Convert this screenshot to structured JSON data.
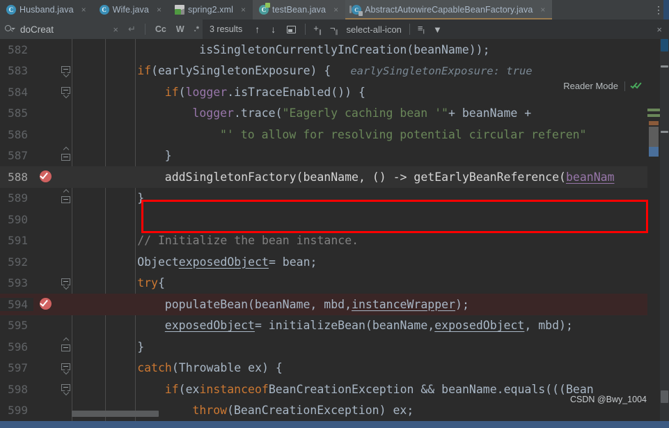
{
  "tabs": [
    {
      "label": "Husband.java",
      "icon": "java-class-icon",
      "state": "inactive",
      "close": "×"
    },
    {
      "label": "Wife.java",
      "icon": "java-class-icon",
      "state": "inactive",
      "close": "×"
    },
    {
      "label": "spring2.xml",
      "icon": "xml-file-icon",
      "state": "inactive",
      "close": "×"
    },
    {
      "label": "testBean.java",
      "icon": "java-test-class-icon",
      "state": "hover",
      "close": "×"
    },
    {
      "label": "AbstractAutowireCapableBeanFactory.java",
      "icon": "abstract-class-icon",
      "state": "active",
      "close": "×"
    }
  ],
  "tabbar": {
    "more_tabs": "⋮"
  },
  "find": {
    "search_icon": "search-icon",
    "query": "doCreat",
    "placeholder": "Search",
    "clear": "×",
    "wrap_icon": "new-line-icon",
    "match_case": "Cc",
    "words": "W",
    "regex": ".*",
    "results": "3 results",
    "prev": "↑",
    "next": "↓",
    "select_all_occurrences": "select-all-icon",
    "filter": "filter-icon",
    "close": "×"
  },
  "editor": {
    "reader_mode": "Reader Mode",
    "reader_check": "inspections-ok-icon",
    "first_line": 582,
    "lines": [
      {
        "num": "582",
        "fold": "",
        "marker": "",
        "state": "",
        "indent": 17,
        "tokens": [
          {
            "t": "isSingletonCurrentlyInCreation(beanName));",
            "c": "ident"
          }
        ]
      },
      {
        "num": "583",
        "fold": "start",
        "marker": "",
        "state": "",
        "indent": 8,
        "tokens": [
          {
            "t": "if",
            "c": "kw"
          },
          {
            "t": " (earlySingletonExposure) {",
            "c": "ident"
          }
        ],
        "hint": "earlySingletonExposure: true"
      },
      {
        "num": "584",
        "fold": "start",
        "marker": "",
        "state": "",
        "indent": 12,
        "tokens": [
          {
            "t": "if",
            "c": "kw"
          },
          {
            "t": " (",
            "c": "ident"
          },
          {
            "t": "logger",
            "c": "fld"
          },
          {
            "t": ".isTraceEnabled()) {",
            "c": "ident"
          }
        ]
      },
      {
        "num": "585",
        "fold": "",
        "marker": "",
        "state": "",
        "indent": 16,
        "tokens": [
          {
            "t": "logger",
            "c": "fld"
          },
          {
            "t": ".trace(",
            "c": "ident"
          },
          {
            "t": "\"Eagerly caching bean '\"",
            "c": "str"
          },
          {
            "t": " + beanName +",
            "c": "ident"
          }
        ]
      },
      {
        "num": "586",
        "fold": "",
        "marker": "",
        "state": "",
        "indent": 20,
        "tokens": [
          {
            "t": "\"' to allow for resolving potential circular referen\"",
            "c": "str"
          }
        ]
      },
      {
        "num": "587",
        "fold": "end",
        "marker": "",
        "state": "",
        "indent": 12,
        "tokens": [
          {
            "t": "}",
            "c": "ident"
          }
        ]
      },
      {
        "num": "588",
        "fold": "",
        "marker": "breakpoint-verified",
        "state": "selected",
        "indent": 12,
        "tokens": [
          {
            "t": "addSingletonFactory(beanName, () -> getEarlyBeanReference(",
            "c": "white"
          },
          {
            "t": "beanNam",
            "c": "purpund"
          }
        ]
      },
      {
        "num": "589",
        "fold": "end",
        "marker": "",
        "state": "",
        "indent": 8,
        "tokens": [
          {
            "t": "}",
            "c": "ident"
          }
        ]
      },
      {
        "num": "590",
        "fold": "",
        "marker": "",
        "state": "",
        "indent": 0,
        "tokens": []
      },
      {
        "num": "591",
        "fold": "",
        "marker": "",
        "state": "",
        "indent": 8,
        "tokens": [
          {
            "t": "// Initialize the bean instance.",
            "c": "cmt"
          }
        ]
      },
      {
        "num": "592",
        "fold": "",
        "marker": "",
        "state": "",
        "indent": 8,
        "tokens": [
          {
            "t": "Object ",
            "c": "ident"
          },
          {
            "t": "exposedObject",
            "c": "undv"
          },
          {
            "t": " = bean;",
            "c": "ident"
          }
        ]
      },
      {
        "num": "593",
        "fold": "start",
        "marker": "",
        "state": "",
        "indent": 8,
        "tokens": [
          {
            "t": "try",
            "c": "kw"
          },
          {
            "t": " {",
            "c": "ident"
          }
        ]
      },
      {
        "num": "594",
        "fold": "",
        "marker": "breakpoint-verified",
        "state": "error",
        "indent": 12,
        "tokens": [
          {
            "t": "populateBean(beanName, mbd, ",
            "c": "ident"
          },
          {
            "t": "instanceWrapper",
            "c": "undv"
          },
          {
            "t": ");",
            "c": "ident"
          }
        ]
      },
      {
        "num": "595",
        "fold": "",
        "marker": "",
        "state": "",
        "indent": 12,
        "tokens": [
          {
            "t": "exposedObject",
            "c": "undv"
          },
          {
            "t": " = initializeBean(beanName, ",
            "c": "ident"
          },
          {
            "t": "exposedObject",
            "c": "undv"
          },
          {
            "t": ", mbd);",
            "c": "ident"
          }
        ]
      },
      {
        "num": "596",
        "fold": "end",
        "marker": "",
        "state": "",
        "indent": 8,
        "tokens": [
          {
            "t": "}",
            "c": "ident"
          }
        ]
      },
      {
        "num": "597",
        "fold": "start",
        "marker": "",
        "state": "",
        "indent": 8,
        "tokens": [
          {
            "t": "catch",
            "c": "kw"
          },
          {
            "t": " (Throwable ex) {",
            "c": "ident"
          }
        ]
      },
      {
        "num": "598",
        "fold": "start",
        "marker": "",
        "state": "",
        "indent": 12,
        "tokens": [
          {
            "t": "if",
            "c": "kw"
          },
          {
            "t": " (ex ",
            "c": "ident"
          },
          {
            "t": "instanceof",
            "c": "kw"
          },
          {
            "t": " BeanCreationException && beanName.equals(((Bean",
            "c": "ident"
          }
        ]
      },
      {
        "num": "599",
        "fold": "",
        "marker": "",
        "state": "",
        "indent": 16,
        "tokens": [
          {
            "t": "throw",
            "c": "kw"
          },
          {
            "t": " (BeanCreationException) ex;",
            "c": "ident"
          }
        ]
      }
    ]
  },
  "annotation": {
    "type": "red-rectangle-highlight",
    "color": "#ff0000",
    "target_line": "588"
  },
  "watermark": "CSDN @Bwy_1004",
  "colors": {
    "background": "#2b2b2b",
    "chrome": "#3c3f41",
    "selection": "#2f65ad",
    "error_line": "#3a2626",
    "keyword": "#cc7832",
    "string": "#6a8759",
    "comment": "#808080",
    "field": "#9876aa",
    "identifier": "#a9b7c6",
    "accent": "#ff0000"
  }
}
